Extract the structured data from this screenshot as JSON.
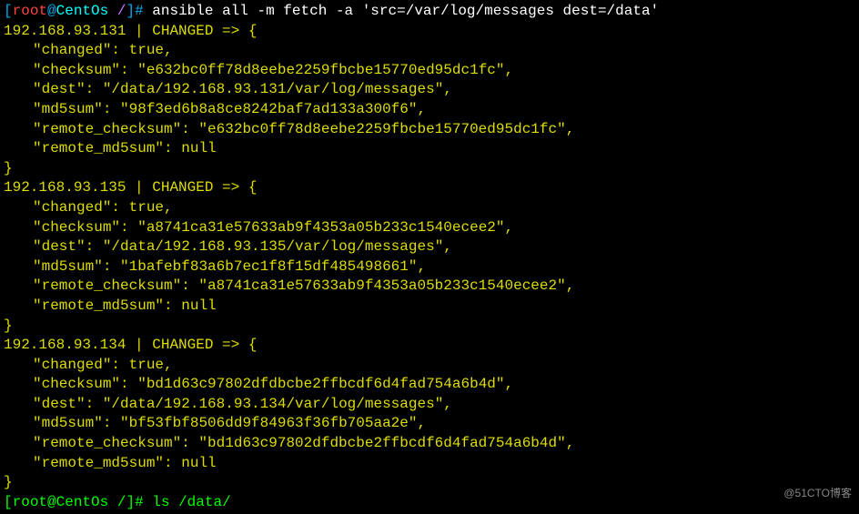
{
  "prompt": {
    "user": "root",
    "host": "CentOs",
    "path": "/",
    "command": "ansible all -m fetch -a 'src=/var/log/messages dest=/data'"
  },
  "results": [
    {
      "host": "192.168.93.131",
      "status": "CHANGED",
      "changed": "true",
      "checksum": "e632bc0ff78d8eebe2259fbcbe15770ed95dc1fc",
      "dest": "/data/192.168.93.131/var/log/messages",
      "md5sum": "98f3ed6b8a8ce8242baf7ad133a300f6",
      "remote_checksum": "e632bc0ff78d8eebe2259fbcbe15770ed95dc1fc",
      "remote_md5sum": "null"
    },
    {
      "host": "192.168.93.135",
      "status": "CHANGED",
      "changed": "true",
      "checksum": "a8741ca31e57633ab9f4353a05b233c1540ecee2",
      "dest": "/data/192.168.93.135/var/log/messages",
      "md5sum": "1bafebf83a6b7ec1f8f15df485498661",
      "remote_checksum": "a8741ca31e57633ab9f4353a05b233c1540ecee2",
      "remote_md5sum": "null"
    },
    {
      "host": "192.168.93.134",
      "status": "CHANGED",
      "changed": "true",
      "checksum": "bd1d63c97802dfdbcbe2ffbcdf6d4fad754a6b4d",
      "dest": "/data/192.168.93.134/var/log/messages",
      "md5sum": "bf53fbf8506dd9f84963f36fb705aa2e",
      "remote_checksum": "bd1d63c97802dfdbcbe2ffbcdf6d4fad754a6b4d",
      "remote_md5sum": "null"
    }
  ],
  "prompt2": {
    "command": "ls /data/"
  },
  "watermark": "@51CTO博客"
}
